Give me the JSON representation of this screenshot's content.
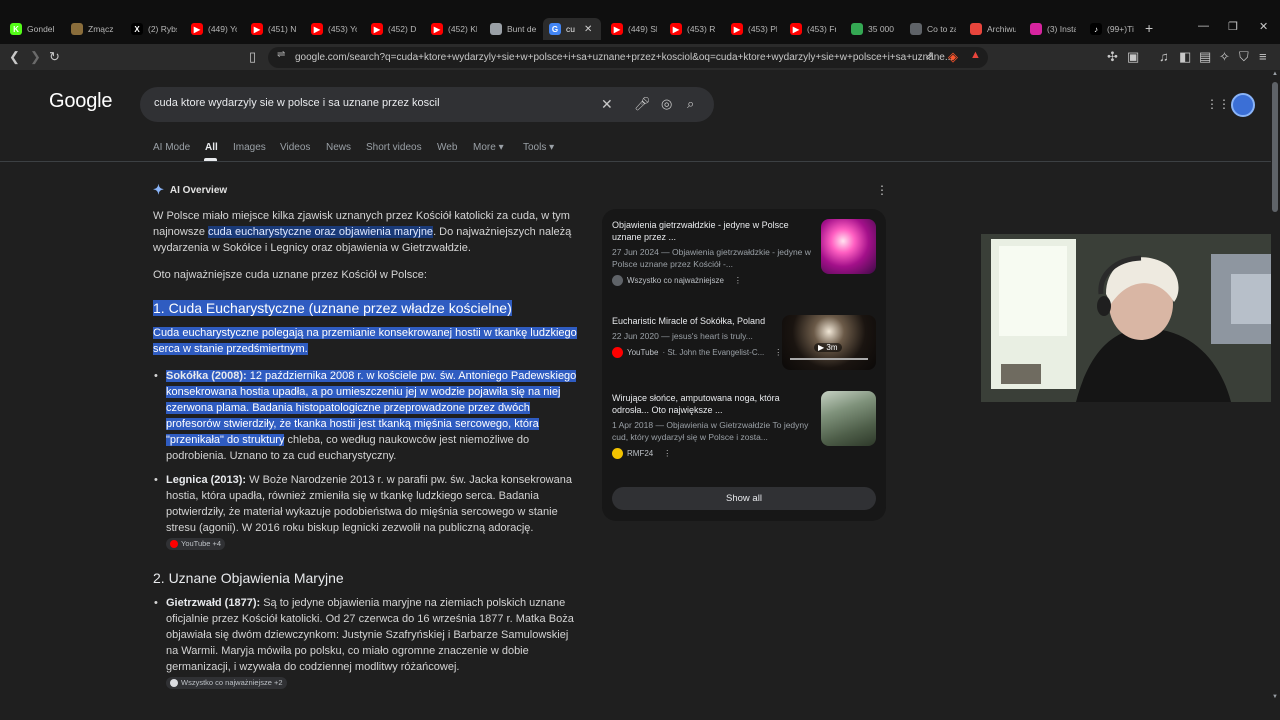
{
  "tabs": [
    {
      "label": "Gondel",
      "fav": "K",
      "color": "#53fc18"
    },
    {
      "label": "Zmącz",
      "fav": "",
      "color": "#8a6d3b"
    },
    {
      "label": "(2) Rybs",
      "fav": "X",
      "color": "#000000"
    },
    {
      "label": "(449) Yo",
      "fav": "▶",
      "color": "#ff0000"
    },
    {
      "label": "(451) N",
      "fav": "▶",
      "color": "#ff0000"
    },
    {
      "label": "(453) Yo",
      "fav": "▶",
      "color": "#ff0000"
    },
    {
      "label": "(452) D",
      "fav": "▶",
      "color": "#ff0000"
    },
    {
      "label": "(452) Kl",
      "fav": "▶",
      "color": "#ff0000"
    },
    {
      "label": "Bunt de",
      "fav": "",
      "color": "#9aa0a6"
    },
    {
      "label": "cu",
      "fav": "G",
      "color": "#4285f4"
    },
    {
      "label": "(449) Sl",
      "fav": "▶",
      "color": "#ff0000"
    },
    {
      "label": "(453) R",
      "fav": "▶",
      "color": "#ff0000"
    },
    {
      "label": "(453) Pl",
      "fav": "▶",
      "color": "#ff0000"
    },
    {
      "label": "(453) Fr",
      "fav": "▶",
      "color": "#ff0000"
    },
    {
      "label": "35 000",
      "fav": "",
      "color": "#34a853"
    },
    {
      "label": "Co to za",
      "fav": "",
      "color": "#5f6368"
    },
    {
      "label": "Archiwu",
      "fav": "",
      "color": "#e8453c"
    },
    {
      "label": "(3) Insta",
      "fav": "",
      "color": "#d6249f"
    },
    {
      "label": "(99+)Ti",
      "fav": "♪",
      "color": "#000000"
    }
  ],
  "address": {
    "url": "google.com/search?q=cuda+ktore+wydarzyly+sie+w+polsce+i+sa+uznane+przez+kosciol&oq=cuda+ktore+wydarzyly+sie+w+polsce+i+sa+uznane..."
  },
  "google": {
    "logo": "Google",
    "query": "cuda ktore wydarzyly sie w polsce i sa uznane przez koscil",
    "nav": [
      "AI Mode",
      "All",
      "Images",
      "Videos",
      "News",
      "Short videos",
      "Web",
      "More",
      "Tools"
    ]
  },
  "ai_overview": {
    "title": "AI Overview",
    "intro_a": "W Polsce miało miejsce kilka zjawisk uznanych przez Kościół katolicki za cuda, w tym najnowsze ",
    "intro_hl": "cuda eucharystyczne oraz objawienia maryjne",
    "intro_b": ". Do najważniejszych należą wydarzenia w Sokółce i Legnicy oraz objawienia w Gietrzwałdzie.",
    "lead": "Oto najważniejsze cuda uznane przez Kościół w Polsce:",
    "h1": "1. Cuda Eucharystyczne (uznane przez władze kościelne)",
    "h1_desc": "Cuda eucharystyczne polegają na przemianie konsekrowanej hostii w tkankę ludzkiego serca w stanie przedśmiertnym.",
    "sokolka_label": "Sokółka (2008):",
    "sokolka_hl": " 12 października 2008 r. w kościele pw. św. Antoniego Padewskiego konsekrowana hostia upadła, a po umieszczeniu jej w wodzie pojawiła się na niej czerwona plama. Badania histopatologiczne przeprowadzone przez dwóch profesorów stwierdziły, że tkanka hostii jest tkanką mięśnia sercowego, która \"przenikała\" do struktury",
    "sokolka_rest": " chleba, co według naukowców jest niemożliwe do podrobienia. Uznano to za cud eucharystyczny.",
    "legnica_label": "Legnica (2013):",
    "legnica_text": " W Boże Narodzenie 2013 r. w parafii pw. św. Jacka konsekrowana hostia, która upadła, również zmieniła się w tkankę ludzkiego serca. Badania potwierdziły, że materiał wykazuje podobieństwa do mięśnia sercowego w stanie stresu (agonii). W 2016 roku biskup legnicki zezwolił na publiczną adorację.",
    "legnica_chip": "YouTube +4",
    "h2": "2. Uznane Objawienia Maryjne",
    "gietrz_label": "Gietrzwałd (1877):",
    "gietrz_text": " Są to jedyne objawienia maryjne na ziemiach polskich uznane oficjalnie przez Kościół katolicki. Od 27 czerwca do 16 września 1877 r. Matka Boża objawiała się dwóm dziewczynkom: Justynie Szafryńskiej i Barbarze Samulowskiej na Warmii. Maryja mówiła po polsku, co miało ogromne znaczenie w dobie germanizacji, i wzywała do codziennej modlitwy różańcowej.",
    "gietrz_chip": "Wszystko co najważniejsze +2"
  },
  "sources": [
    {
      "title": "Objawienia gietrzwałdzkie - jedyne w Polsce uznane przez ...",
      "snippet": "27 Jun 2024 — Objawienia gietrzwałdzkie - jedyne w Polsce uznane przez Kościół -...",
      "site": "Wszystko co najważniejsze",
      "fav_color": "#5f6368"
    },
    {
      "title": "Eucharistic Miracle of Sokółka, Poland",
      "snippet": "22 Jun 2020 — jesus's heart is truly...",
      "site": "YouTube",
      "site_extra": "· St. John the Evangelist-C...",
      "duration": "3m",
      "fav_color": "#ff0000"
    },
    {
      "title": "Wirujące słońce, amputowana noga, która odrosła... Oto największe ...",
      "snippet": "1 Apr 2018 — Objawienia w Gietrzwałdzie To jedyny cud, który wydarzył się w Polsce i zosta...",
      "site": "RMF24",
      "fav_color": "#f2c200"
    }
  ],
  "show_all": "Show all"
}
